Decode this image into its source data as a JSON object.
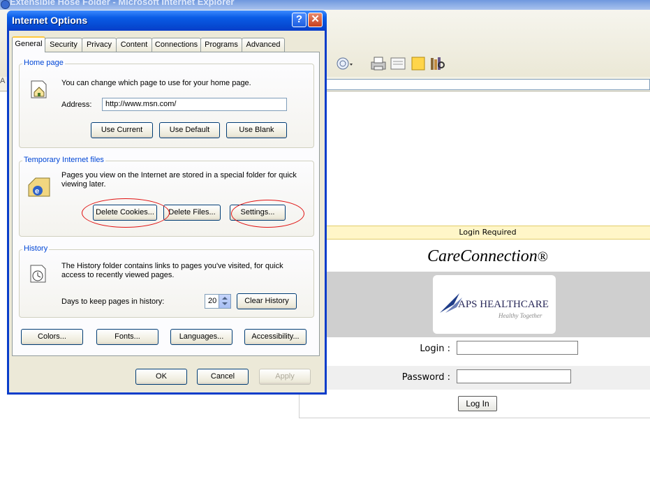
{
  "browser": {
    "title": "Extensible Hose Folder - Microsoft Internet Explorer",
    "left_stub": "A"
  },
  "dialog": {
    "title": "Internet Options",
    "help_glyph": "?",
    "close_glyph": "✕",
    "tabs": [
      "General",
      "Security",
      "Privacy",
      "Content",
      "Connections",
      "Programs",
      "Advanced"
    ],
    "active_tab": "General",
    "home_page": {
      "legend": "Home page",
      "description": "You can change which page to use for your home page.",
      "address_label": "Address:",
      "address_value": "http://www.msn.com/",
      "use_current": "Use Current",
      "use_default": "Use Default",
      "use_blank": "Use Blank"
    },
    "temp_files": {
      "legend": "Temporary Internet files",
      "description": "Pages you view on the Internet are stored in a special folder for quick viewing later.",
      "delete_cookies": "Delete Cookies...",
      "delete_files": "Delete Files...",
      "settings": "Settings..."
    },
    "history": {
      "legend": "History",
      "description": "The History folder contains links to pages you've visited, for quick access to recently viewed pages.",
      "days_label": "Days to keep pages in history:",
      "days_value": "20",
      "clear_history": "Clear History"
    },
    "bottom_buttons": {
      "colors": "Colors...",
      "fonts": "Fonts...",
      "languages": "Languages...",
      "accessibility": "Accessibility..."
    },
    "footer": {
      "ok": "OK",
      "cancel": "Cancel",
      "apply": "Apply"
    }
  },
  "login_page": {
    "banner": "Login Required",
    "app_name": "CareConnection",
    "registered_mark": "®",
    "logo_text": "APS HEALTHCARE",
    "logo_tagline": "Healthy Together",
    "login_label": "Login   :",
    "password_label": "Password   :",
    "login_value": "",
    "password_value": "",
    "login_button": "Log In"
  },
  "colors": {
    "xp_title_blue": "#0a5ce6",
    "dialog_face": "#ece9d8",
    "group_legend": "#0046d5",
    "annotation_red": "#e01010",
    "login_banner": "#fff6c8"
  }
}
